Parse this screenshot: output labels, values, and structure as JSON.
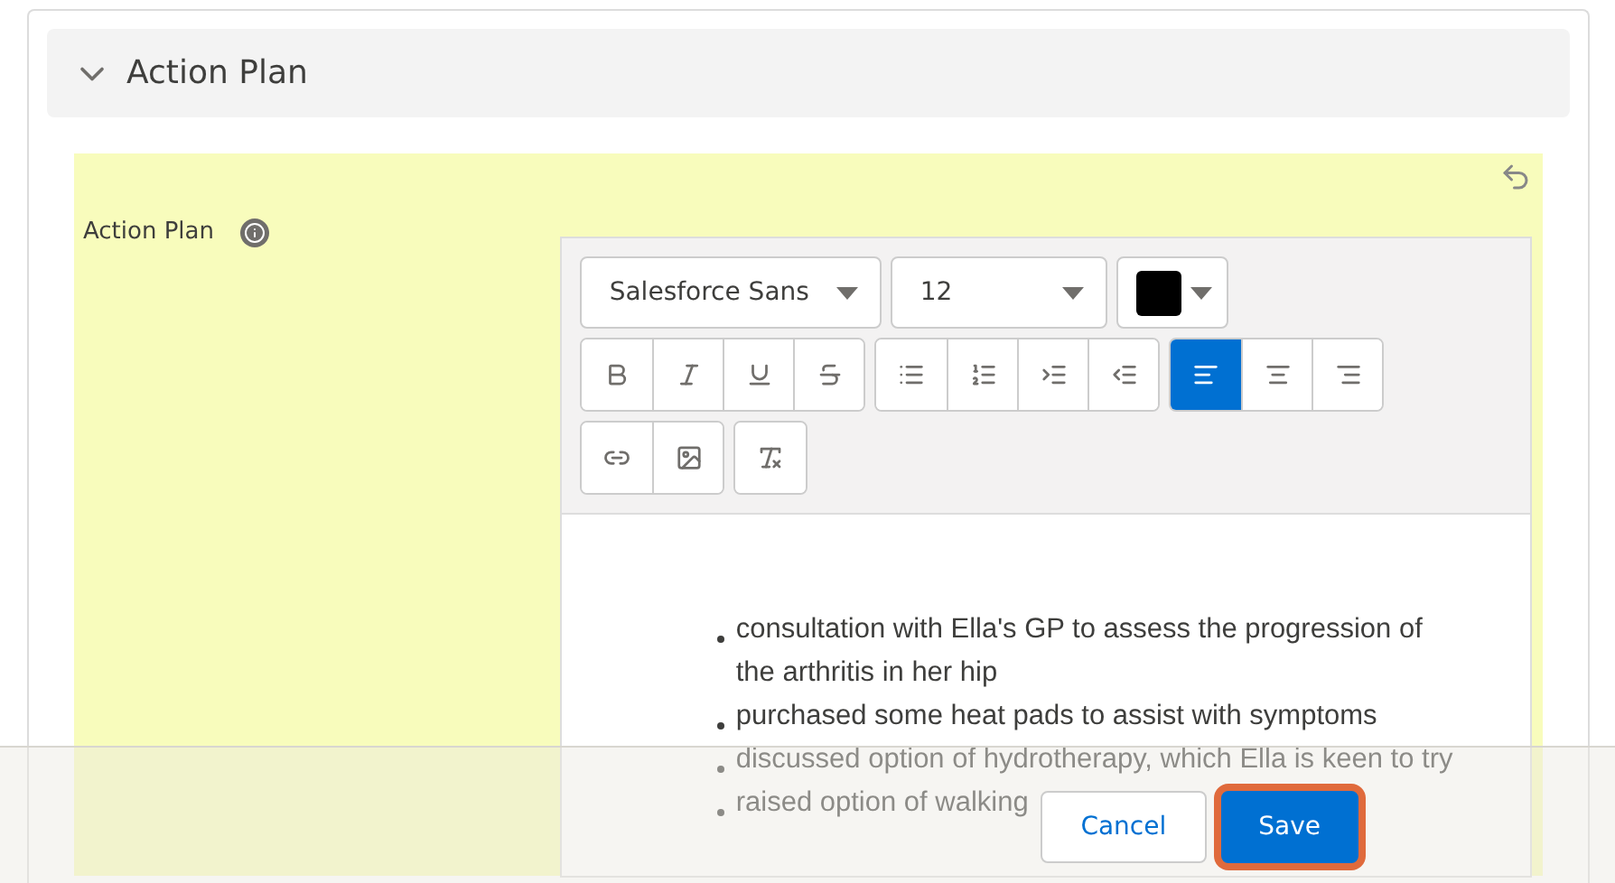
{
  "section": {
    "title": "Action Plan",
    "expanded": true
  },
  "field": {
    "label": "Action Plan",
    "changed": true
  },
  "toolbar": {
    "font": "Salesforce Sans",
    "size": "12",
    "groups": [
      {
        "buttons": [
          {
            "kind": "bold"
          },
          {
            "kind": "italic"
          },
          {
            "kind": "underline"
          },
          {
            "kind": "strike"
          }
        ]
      },
      {
        "buttons": [
          {
            "kind": "bullets"
          },
          {
            "kind": "numbers"
          },
          {
            "kind": "indent"
          },
          {
            "kind": "outdent"
          }
        ]
      },
      {
        "buttons": [
          {
            "kind": "align-left",
            "selected": true
          },
          {
            "kind": "align-center",
            "selected": false
          },
          {
            "kind": "align-right",
            "selected": false
          }
        ]
      },
      {
        "buttons": [
          {
            "kind": "link"
          },
          {
            "kind": "image"
          }
        ]
      },
      {
        "buttons": [
          {
            "kind": "clear"
          }
        ]
      }
    ]
  },
  "content": [
    "consultation with Ella's GP to assess the progression of the arthritis in her hip",
    "purchased some heat pads to assist with symptoms",
    "discussed option of hydrotherapy, which Ella is keen to try",
    "raised option of walking"
  ],
  "footer": {
    "buttons": [
      {
        "label": "Cancel",
        "kind": "neutral",
        "focused": false
      },
      {
        "label": "Save",
        "kind": "brand",
        "focused": true
      }
    ]
  }
}
